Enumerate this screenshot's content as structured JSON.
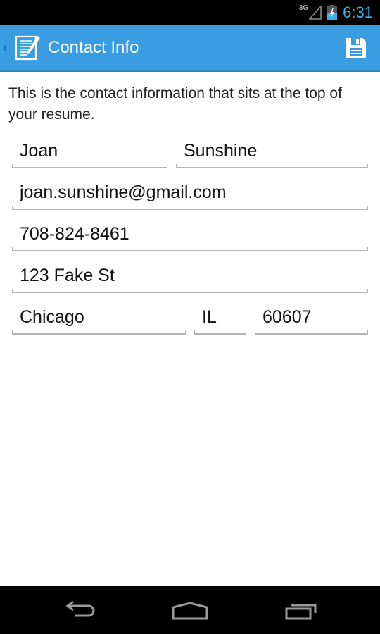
{
  "status_bar": {
    "network_type": "3G",
    "time": "6:31",
    "accent_color": "#33b5e5"
  },
  "action_bar": {
    "title": "Contact Info",
    "background_color": "#3a9de2",
    "up_icon": "chevron-left-icon",
    "app_icon": "resume-edit-icon",
    "save_icon": "floppy-disk-save-icon"
  },
  "content": {
    "intro_text": "This is the contact information that sits at the top of your resume.",
    "fields": {
      "first_name": "Joan",
      "last_name": "Sunshine",
      "email": "joan.sunshine@gmail.com",
      "phone": "708-824-8461",
      "street": "123 Fake St",
      "city": "Chicago",
      "state": "IL",
      "zip": "60607"
    }
  },
  "nav_bar": {
    "back_icon": "back-arrow-icon",
    "home_icon": "home-icon",
    "recents_icon": "recent-apps-icon"
  }
}
